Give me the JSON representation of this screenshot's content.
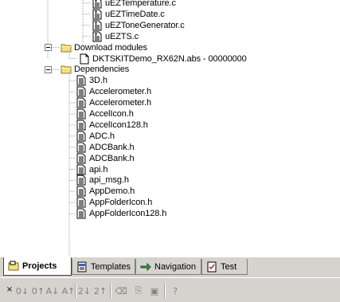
{
  "tree": {
    "c_files": [
      {
        "label": "uEZTemperature.c"
      },
      {
        "label": "uEZTimeDate.c"
      },
      {
        "label": "uEZToneGenerator.c"
      },
      {
        "label": "uEZTS.c"
      }
    ],
    "download_folder": {
      "label": "Download modules",
      "expanded": true
    },
    "download_items": [
      {
        "label": "DKTSKITDemo_RX62N.abs - 00000000"
      }
    ],
    "dependencies_folder": {
      "label": "Dependencies",
      "expanded": true
    },
    "dependencies": [
      {
        "label": "3D.h"
      },
      {
        "label": "Accelerometer.h"
      },
      {
        "label": "Accelerometer.h"
      },
      {
        "label": "AccelIcon.h"
      },
      {
        "label": "AccelIcon128.h"
      },
      {
        "label": "ADC.h"
      },
      {
        "label": "ADCBank.h"
      },
      {
        "label": "ADCBank.h"
      },
      {
        "label": "api.h"
      },
      {
        "label": "api_msg.h"
      },
      {
        "label": "AppDemo.h"
      },
      {
        "label": "AppFolderIcon.h"
      },
      {
        "label": "AppFolderIcon128.h"
      }
    ]
  },
  "tabs": [
    {
      "label": "Projects",
      "icon": "projects-icon",
      "active": true
    },
    {
      "label": "Templates",
      "icon": "templates-icon",
      "active": false
    },
    {
      "label": "Navigation",
      "icon": "navigation-icon",
      "active": false
    },
    {
      "label": "Test",
      "icon": "test-icon",
      "active": false
    }
  ],
  "toolbar": {
    "close_glyph": "×",
    "buttons": [
      {
        "name": "sort-0-icon",
        "glyph": "0↓"
      },
      {
        "name": "sort-0-up-icon",
        "glyph": "0↑"
      },
      {
        "name": "sort-az-icon",
        "glyph": "A↓"
      },
      {
        "name": "sort-za-icon",
        "glyph": "A↑"
      },
      {
        "name": "sort-21-icon",
        "glyph": "2↓"
      },
      {
        "name": "sort-21-up-icon",
        "glyph": "2↑"
      },
      {
        "name": "eraser-icon",
        "glyph": "⌫"
      },
      {
        "name": "copy-icon",
        "glyph": "⎘"
      },
      {
        "name": "save-icon",
        "glyph": "▣"
      },
      {
        "name": "help-icon",
        "glyph": "?"
      }
    ]
  },
  "colors": {
    "folder_fill": "#f7e07a",
    "folder_edge": "#8a7a30",
    "chrome": "#d6d3ce",
    "tree_line": "#a0a0a0"
  }
}
